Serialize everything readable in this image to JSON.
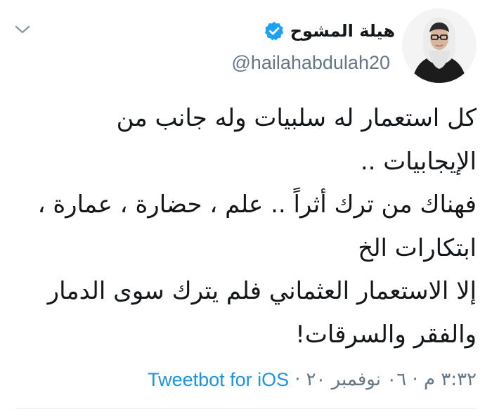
{
  "user": {
    "display_name": "هيلة المشوح",
    "handle": "@hailahabdulah20",
    "verified": true,
    "avatar": "avatar-photo"
  },
  "tweet": {
    "lines": [
      "كل استعمار له سلبيات وله جانب من",
      "الإيجابيات ..",
      "فهناك من ترك أثراً .. علم ، حضارة ، عمارة ،",
      "ابتكارات الخ",
      "إلا الاستعمار العثماني فلم يترك سوى الدمار",
      "والفقر والسرقات!"
    ]
  },
  "meta": {
    "timestamp": "٣:٣٢ م · ٠٦ نوفمبر ٢٠",
    "separator": "·",
    "source": "Tweetbot for iOS"
  },
  "icons": {
    "menu": "chevron-down-icon",
    "verified": "verified-badge-icon"
  },
  "colors": {
    "text": "#14171a",
    "secondary": "#657786",
    "link": "#1b95e0",
    "verified": "#1da1f2",
    "divider": "#e6ecf0"
  }
}
